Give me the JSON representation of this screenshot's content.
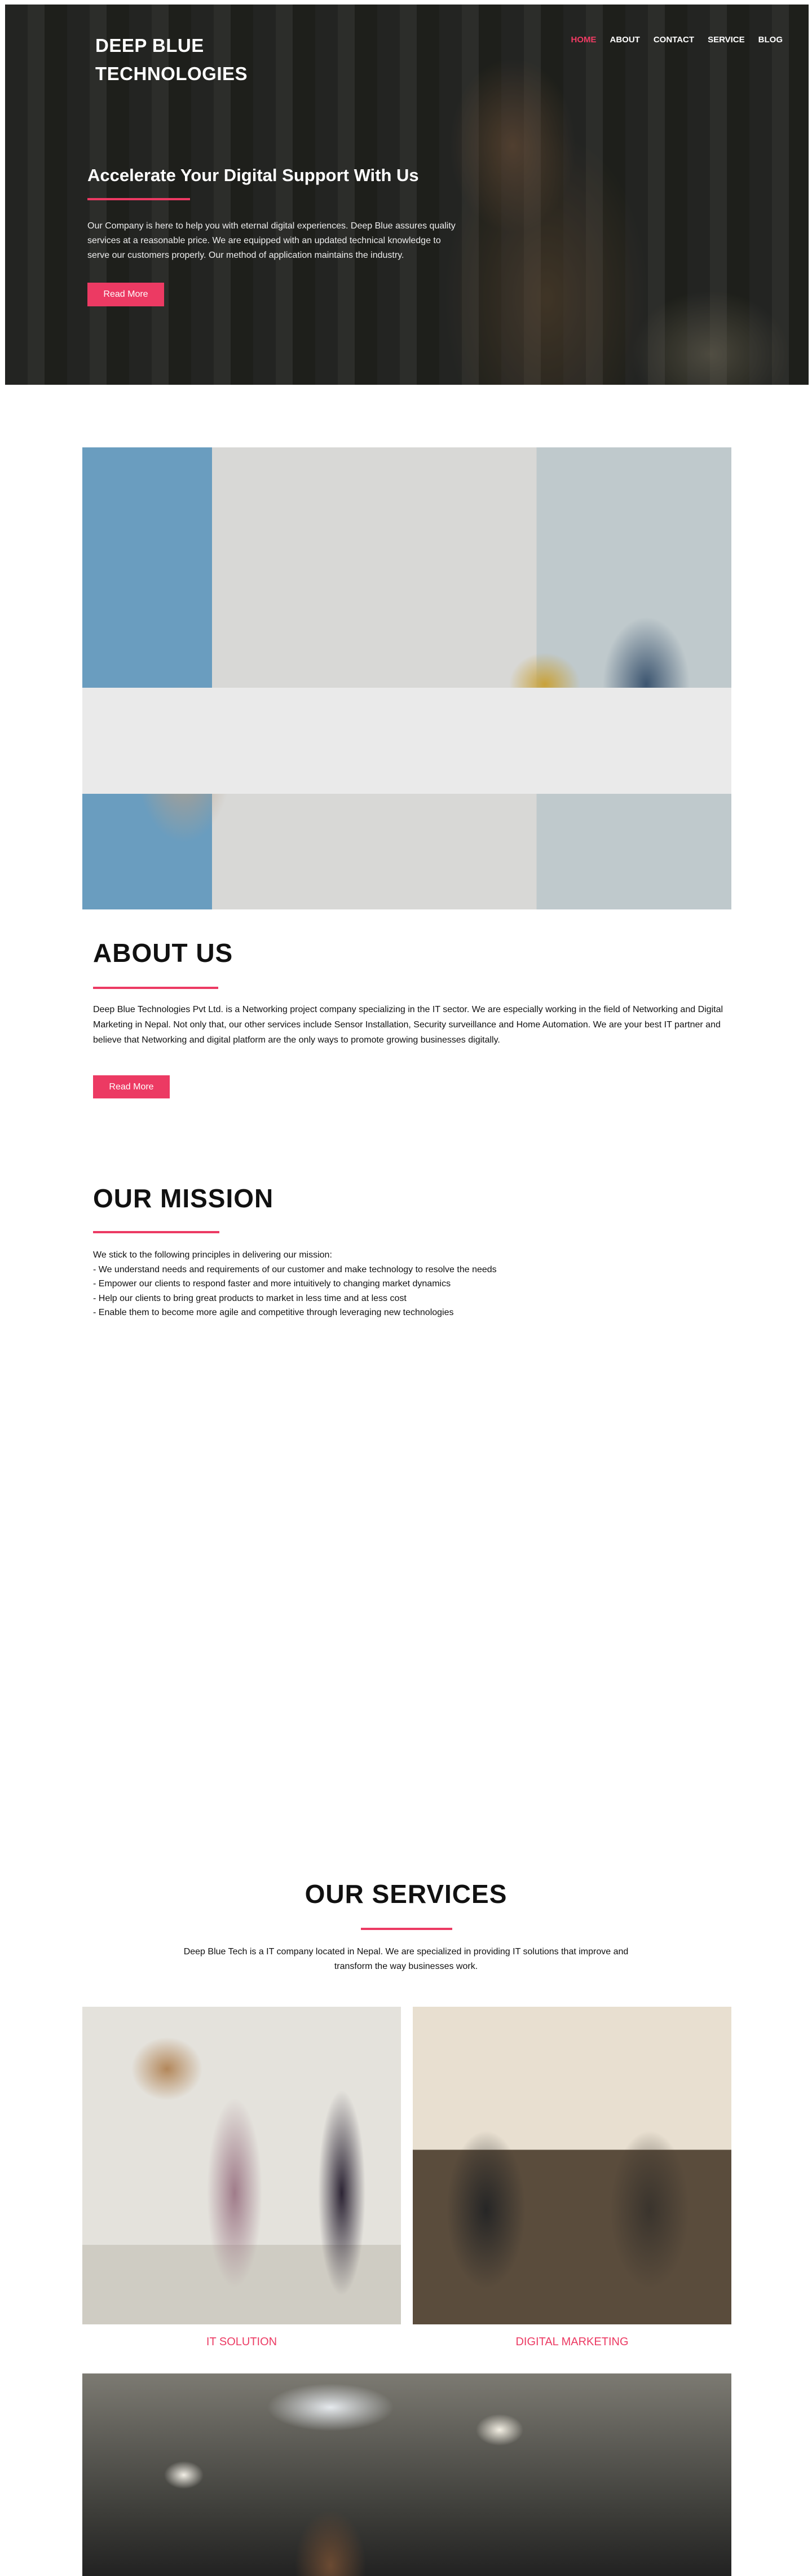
{
  "header": {
    "logo_line1": "DEEP BLUE",
    "logo_line2": "TECHNOLOGIES",
    "nav": [
      {
        "label": "HOME",
        "active": true
      },
      {
        "label": "ABOUT"
      },
      {
        "label": "CONTACT"
      },
      {
        "label": "SERVICE"
      },
      {
        "label": "BLOG"
      }
    ]
  },
  "hero": {
    "title": "Accelerate Your Digital Support With Us",
    "text": "Our Company is here to help you with eternal digital experiences. Deep Blue assures quality services at a reasonable price. We are equipped with an updated technical knowledge to serve our customers properly. Our method of application maintains the industry.",
    "button": "Read More"
  },
  "about": {
    "title": "ABOUT US",
    "text": "Deep Blue Technologies Pvt Ltd. is a Networking project company specializing in the IT sector. We are especially working in the field of Networking and Digital Marketing in Nepal. Not only that, our other services include Sensor Installation, Security surveillance and Home Automation. We are your best IT partner and believe that Networking and digital platform are the only ways to promote growing businesses digitally.",
    "button": "Read More"
  },
  "mission": {
    "title": "OUR MISSION",
    "intro": "We stick to the following principles in delivering our mission:",
    "items": [
      "- We understand needs and requirements of our customer and make technology to resolve the needs",
      "- Empower our clients to respond faster and more intuitively to changing market dynamics",
      "- Help our clients to bring great products to market in less time and at less cost",
      "- Enable them to become more agile and competitive through leveraging new technologies"
    ]
  },
  "services": {
    "title": "OUR SERVICES",
    "text": "Deep Blue Tech is a IT company located in Nepal. We are specialized in providing IT solutions that improve and transform the way businesses work.",
    "items": [
      {
        "label": "IT SOLUTION"
      },
      {
        "label": "DIGITAL MARKETING"
      }
    ]
  },
  "colors": {
    "accent": "#ec3a63"
  }
}
